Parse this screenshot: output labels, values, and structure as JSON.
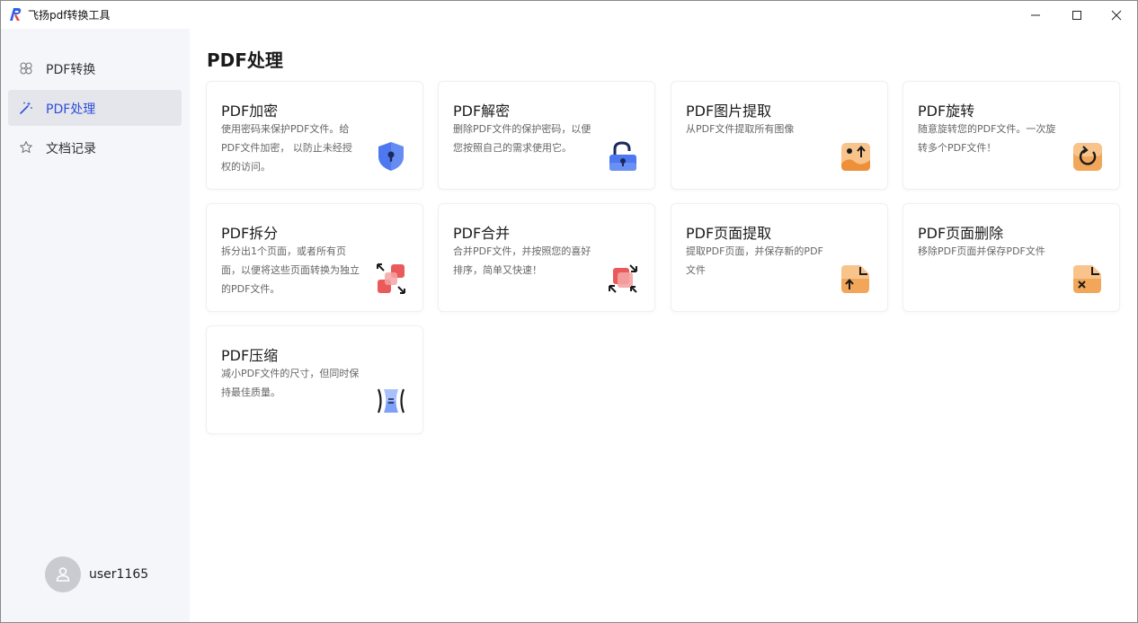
{
  "window": {
    "title": "飞扬pdf转换工具"
  },
  "sidebar": {
    "items": [
      {
        "label": "PDF转换",
        "icon": "grid-icon"
      },
      {
        "label": "PDF处理",
        "icon": "magic-wand-icon",
        "active": true
      },
      {
        "label": "文档记录",
        "icon": "star-icon"
      }
    ],
    "user": {
      "name": "user1165"
    }
  },
  "main": {
    "title": "PDF处理",
    "cards": [
      {
        "title": "PDF加密",
        "desc": "使用密码来保护PDF文件。给PDF文件加密， 以防止未经授权的访问。",
        "icon": "shield-lock-icon"
      },
      {
        "title": "PDF解密",
        "desc": "删除PDF文件的保护密码，以便您按照自己的需求使用它。",
        "icon": "unlock-icon"
      },
      {
        "title": "PDF图片提取",
        "desc": "从PDF文件提取所有图像",
        "icon": "image-extract-icon"
      },
      {
        "title": "PDF旋转",
        "desc": "随意旋转您的PDF文件。一次旋转多个PDF文件！",
        "icon": "rotate-icon"
      },
      {
        "title": "PDF拆分",
        "desc": "拆分出1个页面，或者所有页面，以便将这些页面转换为独立的PDF文件。",
        "icon": "split-icon"
      },
      {
        "title": "PDF合并",
        "desc": "合并PDF文件，并按照您的喜好排序，简单又快速！",
        "icon": "merge-icon"
      },
      {
        "title": "PDF页面提取",
        "desc": "提取PDF页面，并保存新的PDF文件",
        "icon": "page-extract-icon"
      },
      {
        "title": "PDF页面删除",
        "desc": "移除PDF页面并保存PDF文件",
        "icon": "page-delete-icon"
      },
      {
        "title": "PDF压缩",
        "desc": "减小PDF文件的尺寸，但同时保持最佳质量。",
        "icon": "compress-icon"
      }
    ]
  },
  "colors": {
    "accent": "#2f4fd8",
    "sidebar_bg": "#f5f6fa",
    "active_bg": "#e4e6ec",
    "blue_icon": "#4d78f0",
    "orange_icon": "#f2a65a",
    "red_icon": "#ea5a5a"
  }
}
